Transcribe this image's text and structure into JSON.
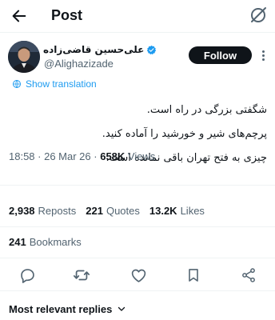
{
  "header": {
    "title": "Post"
  },
  "author": {
    "name": "علی‌حسین قاضی‌زاده",
    "handle": "@Alighazizade",
    "verified": true
  },
  "follow_label": "Follow",
  "translation_label": "Show translation",
  "tweet_lines": [
    "شگفتی بزرگی در راه است.",
    "پرچم‌های شیر و خورشید را آماده کنید.",
    "چیزی به فتح تهران باقی نمانده است."
  ],
  "meta": {
    "time": "18:58",
    "date": "26 Mar 26",
    "views_count": "658K",
    "views_label": "Views"
  },
  "stats": {
    "reposts_count": "2,938",
    "reposts_label": "Reposts",
    "quotes_count": "221",
    "quotes_label": "Quotes",
    "likes_count": "13.2K",
    "likes_label": "Likes",
    "bookmarks_count": "241",
    "bookmarks_label": "Bookmarks"
  },
  "replies_sort_label": "Most relevant replies",
  "colors": {
    "accent": "#1d9bf0",
    "text": "#0f1419",
    "secondary": "#536471",
    "divider": "#eff3f4"
  },
  "icons": [
    "back-arrow-icon",
    "grok-icon",
    "verified-badge-icon",
    "more-icon",
    "translate-icon",
    "reply-icon",
    "repost-icon",
    "like-icon",
    "bookmark-icon",
    "share-icon",
    "chevron-down-icon"
  ]
}
